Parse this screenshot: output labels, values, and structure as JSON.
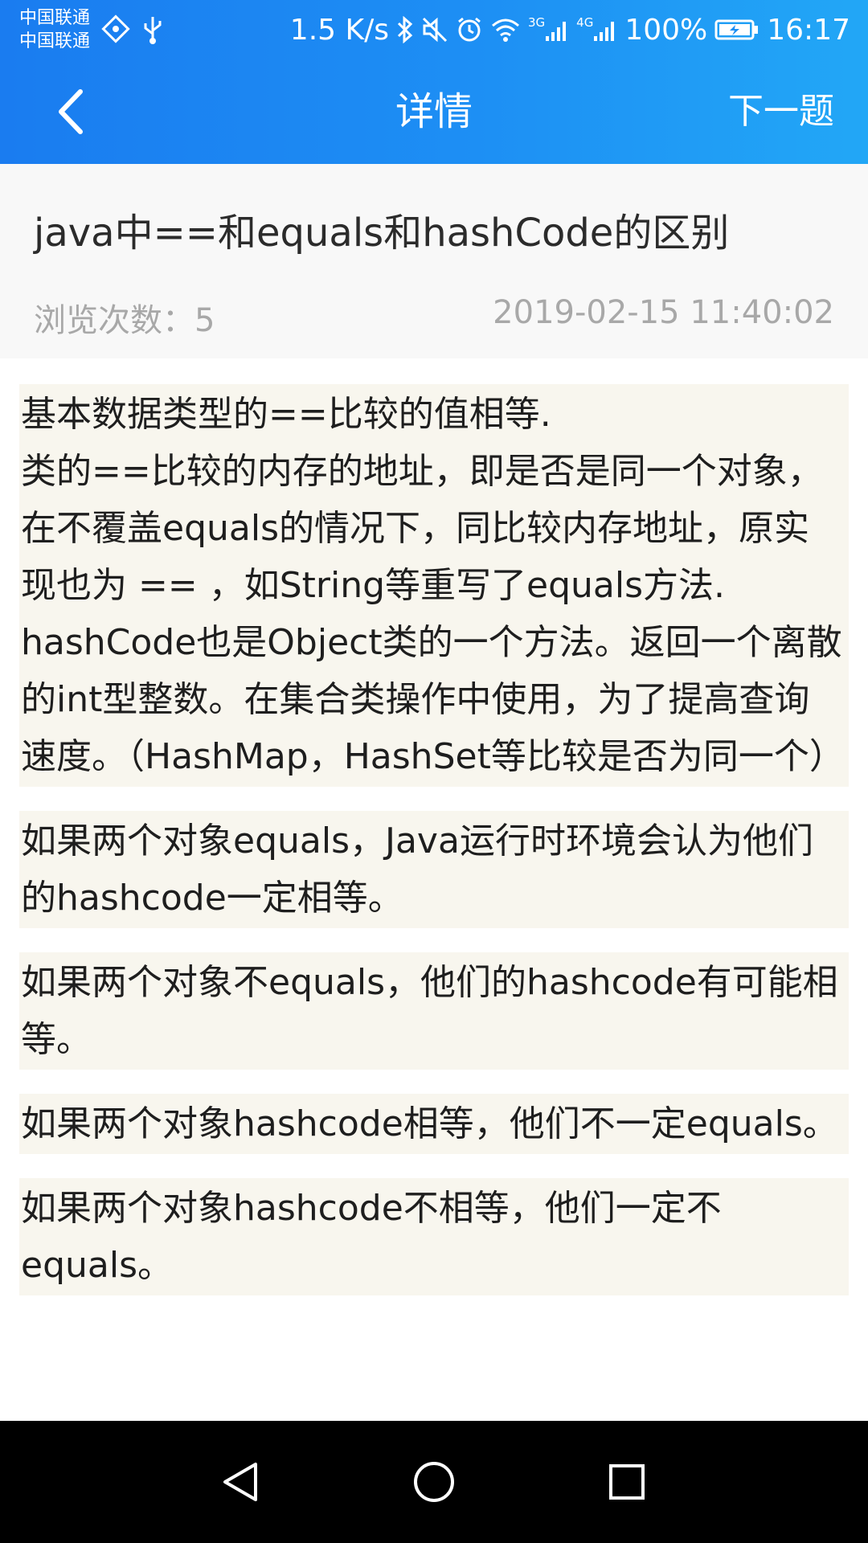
{
  "status_bar": {
    "carrier_1": "中国联通",
    "carrier_2": "中国联通",
    "network_speed": "1.5 K/s",
    "signal_1_label": "3G",
    "signal_2_label": "4G",
    "battery": "100%",
    "time": "16:17",
    "icons": [
      "hotspot-icon",
      "usb-icon",
      "bluetooth-icon",
      "mute-icon",
      "alarm-icon",
      "wifi-icon",
      "signal-icon",
      "signal-icon",
      "battery-icon"
    ]
  },
  "nav_bar": {
    "title": "详情",
    "next_label": "下一题",
    "back_icon": "chevron-left-icon"
  },
  "question": {
    "title": "java中==和equals和hashCode的区别",
    "views_label": "浏览次数：",
    "views_count": "5",
    "date": "2019-02-15 11:40:02"
  },
  "answer_blocks": [
    "基本数据类型的==比较的值相等.\n类的==比较的内存的地址，即是否是同一个对象，在不覆盖equals的情况下，同比较内存地址，原实现也为 == ，如String等重写了equals方法.\nhashCode也是Object类的一个方法。返回一个离散的int型整数。在集合类操作中使用，为了提高查询速度。（HashMap，HashSet等比较是否为同一个）",
    "如果两个对象equals，Java运行时环境会认为他们的hashcode一定相等。",
    "如果两个对象不equals，他们的hashcode有可能相等。",
    "如果两个对象hashcode相等，他们不一定equals。",
    "如果两个对象hashcode不相等，他们一定不equals。"
  ],
  "colors": {
    "header_start": "#1a7cf0",
    "header_end": "#22a7f6",
    "block_bg": "#f8f6ee",
    "meta_text": "#a8a8a8"
  },
  "system_nav": [
    "back-triangle-icon",
    "home-circle-icon",
    "recents-square-icon"
  ]
}
